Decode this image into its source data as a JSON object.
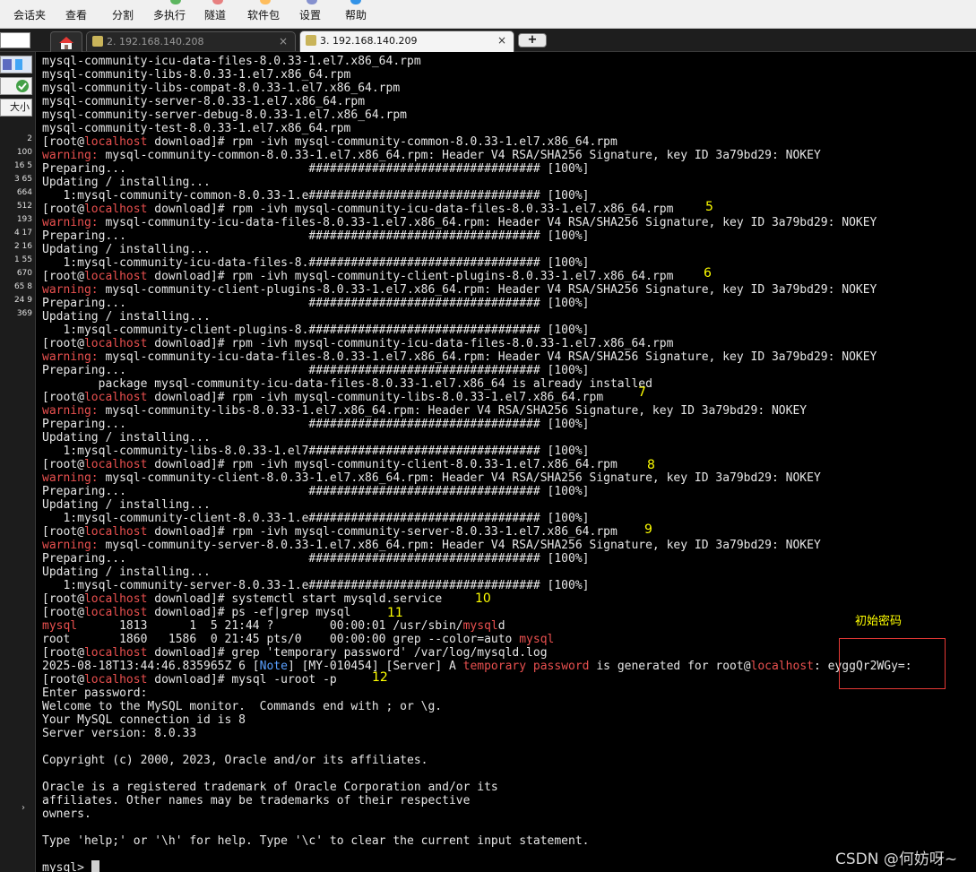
{
  "menu": {
    "items": [
      "会话夹",
      "查看",
      "分割",
      "多执行",
      "隧道",
      "软件包",
      "设置",
      "帮助"
    ]
  },
  "tabs": [
    {
      "label": "2. 192.168.140.208",
      "close": "×"
    },
    {
      "label": "3. 192.168.140.209",
      "close": "×"
    }
  ],
  "new_tab": "+",
  "left_panel": {
    "partial_text": "大小",
    "items": [
      "2",
      "100",
      "16 5",
      "3 65",
      "664",
      "512",
      "193",
      "4 17",
      "2 16",
      "1 55",
      "670",
      "65 8",
      "24 9",
      "369"
    ],
    "arrow": "›"
  },
  "terminal": {
    "lines": [
      [
        {
          "t": "mysql-community-icu-data-files-8.0.33-1.el7.x86_64.rpm"
        }
      ],
      [
        {
          "t": "mysql-community-libs-8.0.33-1.el7.x86_64.rpm"
        }
      ],
      [
        {
          "t": "mysql-community-libs-compat-8.0.33-1.el7.x86_64.rpm"
        }
      ],
      [
        {
          "t": "mysql-community-server-8.0.33-1.el7.x86_64.rpm"
        }
      ],
      [
        {
          "t": "mysql-community-server-debug-8.0.33-1.el7.x86_64.rpm"
        }
      ],
      [
        {
          "t": "mysql-community-test-8.0.33-1.el7.x86_64.rpm"
        }
      ],
      [
        {
          "t": "[root@"
        },
        {
          "t": "localhost",
          "c": "red"
        },
        {
          "t": " download]# rpm -ivh mysql-community-common-8.0.33-1.el7.x86_64.rpm"
        }
      ],
      [
        {
          "t": "warning:",
          "c": "red"
        },
        {
          "t": " mysql-community-common-8.0.33-1.el7.x86_64.rpm: Header V4 RSA/SHA256 Signature, key ID 3a79bd29: NOKEY"
        }
      ],
      [
        {
          "t": "Preparing...                          ################################# [100%]"
        }
      ],
      [
        {
          "t": "Updating / installing..."
        }
      ],
      [
        {
          "t": "   1:mysql-community-common-8.0.33-1.e################################# [100%]"
        }
      ],
      [
        {
          "t": "[root@"
        },
        {
          "t": "localhost",
          "c": "red"
        },
        {
          "t": " download]# rpm -ivh mysql-community-icu-data-files-8.0.33-1.el7.x86_64.rpm"
        }
      ],
      [
        {
          "t": "warning:",
          "c": "red"
        },
        {
          "t": " mysql-community-icu-data-files-8.0.33-1.el7.x86_64.rpm: Header V4 RSA/SHA256 Signature, key ID 3a79bd29: NOKEY"
        }
      ],
      [
        {
          "t": "Preparing...                          ################################# [100%]"
        }
      ],
      [
        {
          "t": "Updating / installing..."
        }
      ],
      [
        {
          "t": "   1:mysql-community-icu-data-files-8.################################# [100%]"
        }
      ],
      [
        {
          "t": "[root@"
        },
        {
          "t": "localhost",
          "c": "red"
        },
        {
          "t": " download]# rpm -ivh mysql-community-client-plugins-8.0.33-1.el7.x86_64.rpm"
        }
      ],
      [
        {
          "t": "warning:",
          "c": "red"
        },
        {
          "t": " mysql-community-client-plugins-8.0.33-1.el7.x86_64.rpm: Header V4 RSA/SHA256 Signature, key ID 3a79bd29: NOKEY"
        }
      ],
      [
        {
          "t": "Preparing...                          ################################# [100%]"
        }
      ],
      [
        {
          "t": "Updating / installing..."
        }
      ],
      [
        {
          "t": "   1:mysql-community-client-plugins-8.################################# [100%]"
        }
      ],
      [
        {
          "t": "[root@"
        },
        {
          "t": "localhost",
          "c": "red"
        },
        {
          "t": " download]# rpm -ivh mysql-community-icu-data-files-8.0.33-1.el7.x86_64.rpm"
        }
      ],
      [
        {
          "t": "warning:",
          "c": "red"
        },
        {
          "t": " mysql-community-icu-data-files-8.0.33-1.el7.x86_64.rpm: Header V4 RSA/SHA256 Signature, key ID 3a79bd29: NOKEY"
        }
      ],
      [
        {
          "t": "Preparing...                          ################################# [100%]"
        }
      ],
      [
        {
          "t": "        package mysql-community-icu-data-files-8.0.33-1.el7.x86_64 is already installed"
        }
      ],
      [
        {
          "t": "[root@"
        },
        {
          "t": "localhost",
          "c": "red"
        },
        {
          "t": " download]# rpm -ivh mysql-community-libs-8.0.33-1.el7.x86_64.rpm"
        }
      ],
      [
        {
          "t": "warning:",
          "c": "red"
        },
        {
          "t": " mysql-community-libs-8.0.33-1.el7.x86_64.rpm: Header V4 RSA/SHA256 Signature, key ID 3a79bd29: NOKEY"
        }
      ],
      [
        {
          "t": "Preparing...                          ################################# [100%]"
        }
      ],
      [
        {
          "t": "Updating / installing..."
        }
      ],
      [
        {
          "t": "   1:mysql-community-libs-8.0.33-1.el7################################# [100%]"
        }
      ],
      [
        {
          "t": "[root@"
        },
        {
          "t": "localhost",
          "c": "red"
        },
        {
          "t": " download]# rpm -ivh mysql-community-client-8.0.33-1.el7.x86_64.rpm"
        }
      ],
      [
        {
          "t": "warning:",
          "c": "red"
        },
        {
          "t": " mysql-community-client-8.0.33-1.el7.x86_64.rpm: Header V4 RSA/SHA256 Signature, key ID 3a79bd29: NOKEY"
        }
      ],
      [
        {
          "t": "Preparing...                          ################################# [100%]"
        }
      ],
      [
        {
          "t": "Updating / installing..."
        }
      ],
      [
        {
          "t": "   1:mysql-community-client-8.0.33-1.e################################# [100%]"
        }
      ],
      [
        {
          "t": "[root@"
        },
        {
          "t": "localhost",
          "c": "red"
        },
        {
          "t": " download]# rpm -ivh mysql-community-server-8.0.33-1.el7.x86_64.rpm"
        }
      ],
      [
        {
          "t": "warning:",
          "c": "red"
        },
        {
          "t": " mysql-community-server-8.0.33-1.el7.x86_64.rpm: Header V4 RSA/SHA256 Signature, key ID 3a79bd29: NOKEY"
        }
      ],
      [
        {
          "t": "Preparing...                          ################################# [100%]"
        }
      ],
      [
        {
          "t": "Updating / installing..."
        }
      ],
      [
        {
          "t": "   1:mysql-community-server-8.0.33-1.e################################# [100%]"
        }
      ],
      [
        {
          "t": "[root@"
        },
        {
          "t": "localhost",
          "c": "red"
        },
        {
          "t": " download]# systemctl start mysqld.service"
        }
      ],
      [
        {
          "t": "[root@"
        },
        {
          "t": "localhost",
          "c": "red"
        },
        {
          "t": " download]# ps -ef|grep mysql"
        }
      ],
      [
        {
          "t": "mysql",
          "c": "red"
        },
        {
          "t": "      1813      1  5 21:44 ?        00:00:01 /usr/sbin/"
        },
        {
          "t": "mysql",
          "c": "red"
        },
        {
          "t": "d"
        }
      ],
      [
        {
          "t": "root       1860   1586  0 21:45 pts/0    00:00:00 grep --color=auto "
        },
        {
          "t": "mysql",
          "c": "red"
        }
      ],
      [
        {
          "t": "[root@"
        },
        {
          "t": "localhost",
          "c": "red"
        },
        {
          "t": " download]# grep 'temporary password' /var/log/mysqld.log"
        }
      ],
      [
        {
          "t": "2025-08-18T13:44:46.835965Z 6 ["
        },
        {
          "t": "Note",
          "c": "blue"
        },
        {
          "t": "] [MY-010454] [Server] A "
        },
        {
          "t": "temporary password",
          "c": "red"
        },
        {
          "t": " is generated for root@"
        },
        {
          "t": "localhost",
          "c": "red"
        },
        {
          "t": ": eyggQr2WGy=:"
        }
      ],
      [
        {
          "t": "[root@"
        },
        {
          "t": "localhost",
          "c": "red"
        },
        {
          "t": " download]# mysql -uroot -p"
        }
      ],
      [
        {
          "t": "Enter password:"
        }
      ],
      [
        {
          "t": "Welcome to the MySQL monitor.  Commands end with ; or \\g."
        }
      ],
      [
        {
          "t": "Your MySQL connection id is 8"
        }
      ],
      [
        {
          "t": "Server version: 8.0.33"
        }
      ],
      [
        {
          "t": ""
        }
      ],
      [
        {
          "t": "Copyright (c) 2000, 2023, Oracle and/or its affiliates."
        }
      ],
      [
        {
          "t": ""
        }
      ],
      [
        {
          "t": "Oracle is a registered trademark of Oracle Corporation and/or its"
        }
      ],
      [
        {
          "t": "affiliates. Other names may be trademarks of their respective"
        }
      ],
      [
        {
          "t": "owners."
        }
      ],
      [
        {
          "t": ""
        }
      ],
      [
        {
          "t": "Type 'help;' or '\\h' for help. Type '\\c' to clear the current input statement."
        }
      ],
      [
        {
          "t": ""
        }
      ],
      [
        {
          "t": "mysql> "
        }
      ]
    ],
    "step_numbers": [
      "5",
      "6",
      "7",
      "8",
      "9",
      "10",
      "11",
      "12"
    ]
  },
  "annotation": {
    "password_label": "初始密码"
  },
  "watermark": "CSDN @何妨呀~"
}
